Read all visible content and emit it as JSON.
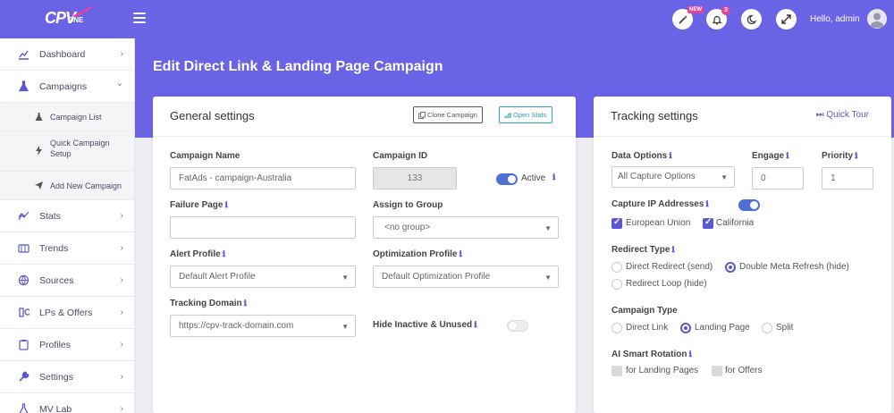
{
  "brand": {
    "logo_text": "CPV",
    "logo_sub": "ONE"
  },
  "topbar": {
    "new_badge": "NEW",
    "notification_count": "3",
    "greeting": "Hello, admin"
  },
  "sidebar": {
    "items": [
      {
        "label": "Dashboard",
        "icon": "chart-line-icon",
        "chevron": "›"
      },
      {
        "label": "Campaigns",
        "icon": "flask-icon",
        "chevron": "⌄"
      },
      {
        "label": "Stats",
        "icon": "stats-icon",
        "chevron": "›"
      },
      {
        "label": "Trends",
        "icon": "trends-icon",
        "chevron": "›"
      },
      {
        "label": "Sources",
        "icon": "globe-icon",
        "chevron": "›"
      },
      {
        "label": "LPs & Offers",
        "icon": "lp-icon",
        "chevron": "›"
      },
      {
        "label": "Profiles",
        "icon": "clipboard-icon",
        "chevron": "›"
      },
      {
        "label": "Settings",
        "icon": "wrench-icon",
        "chevron": "›"
      },
      {
        "label": "MV Lab",
        "icon": "flask-icon",
        "chevron": "›"
      }
    ],
    "sub_items": [
      {
        "label": "Campaign List"
      },
      {
        "label": "Quick Campaign Setup"
      },
      {
        "label": "Add New Campaign"
      }
    ]
  },
  "page": {
    "title": "Edit Direct Link & Landing Page Campaign"
  },
  "general": {
    "title": "General settings",
    "clone_button": "Clone Campaign",
    "stats_button": "Open Stats",
    "campaign_name_label": "Campaign Name",
    "campaign_name_value": "FatAds - campaign-Australia",
    "campaign_id_label": "Campaign ID",
    "campaign_id_value": "133",
    "active_label": "Active",
    "failure_page_label": "Failure Page",
    "failure_page_value": "",
    "assign_group_label": "Assign to Group",
    "assign_group_value": "<no group>",
    "alert_profile_label": "Alert Profile",
    "alert_profile_value": "Default Alert Profile",
    "optimization_profile_label": "Optimization Profile",
    "optimization_profile_value": "Default Optimization Profile",
    "tracking_domain_label": "Tracking Domain",
    "tracking_domain_value": "https://cpv-track-domain.com",
    "hide_inactive_label": "Hide Inactive & Unused",
    "active_on": true,
    "hide_inactive_on": false
  },
  "tracking": {
    "title": "Tracking settings",
    "quick_tour": "Quick Tour",
    "data_options_label": "Data Options",
    "data_options_value": "All Capture Options",
    "engage_label": "Engage",
    "engage_value": "0",
    "priority_label": "Priority",
    "priority_value": "1",
    "capture_ip_label": "Capture IP Addresses",
    "capture_ip_on": true,
    "eu_label": "European Union",
    "california_label": "California",
    "redirect_type_label": "Redirect Type",
    "redirect_options": [
      "Direct Redirect (send)",
      "Double Meta Refresh (hide)",
      "Redirect Loop (hide)"
    ],
    "redirect_selected": "Double Meta Refresh (hide)",
    "campaign_type_label": "Campaign Type",
    "campaign_type_options": [
      "Direct Link",
      "Landing Page",
      "Split"
    ],
    "campaign_type_selected": "Landing Page",
    "ai_rotation_label": "AI Smart Rotation",
    "ai_landing_label": "for Landing Pages",
    "ai_offers_label": "for Offers"
  },
  "colors": {
    "accent": "#6b63e6",
    "primary": "#5b57d6",
    "teal": "#2ba3b8"
  }
}
